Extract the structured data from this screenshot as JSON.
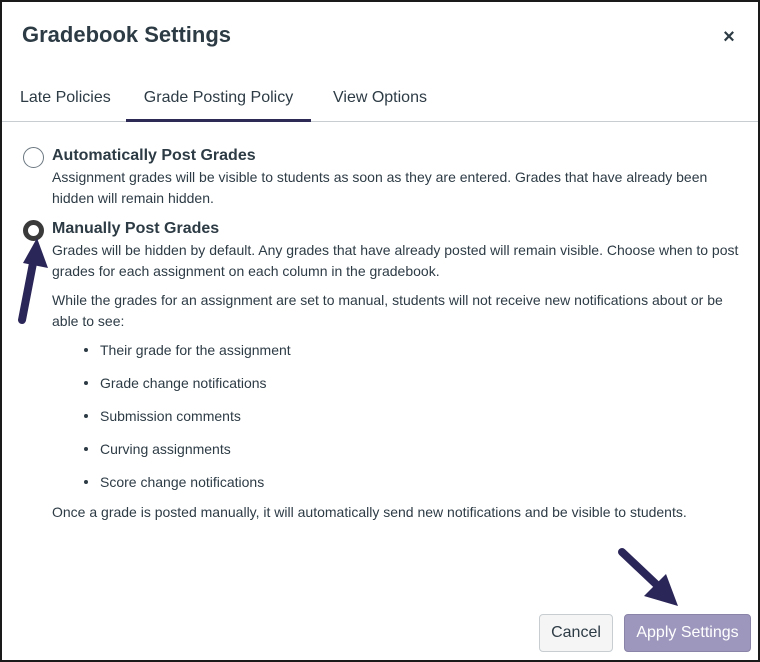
{
  "dialog": {
    "title": "Gradebook Settings",
    "close_glyph": "×"
  },
  "tabs": [
    {
      "label": "Late Policies",
      "active": false
    },
    {
      "label": "Grade Posting Policy",
      "active": true
    },
    {
      "label": "View Options",
      "active": false
    }
  ],
  "options": {
    "automatic": {
      "title": "Automatically Post Grades",
      "description": "Assignment grades will be visible to students as soon as they are entered. Grades that have already been hidden will remain hidden.",
      "selected": false
    },
    "manual": {
      "title": "Manually Post Grades",
      "description": "Grades will be hidden by default. Any grades that have already posted will remain visible. Choose when to post grades for each assignment on each column in the gradebook.",
      "selected": true,
      "manual_note": "While the grades for an assignment are set to manual, students will not receive new notifications about or be able to see:",
      "bullets": [
        "Their grade for the assignment",
        "Grade change notifications",
        "Submission comments",
        "Curving assignments",
        "Score change notifications"
      ],
      "footer_note": "Once a grade is posted manually, it will automatically send new notifications and be visible to students."
    }
  },
  "buttons": {
    "cancel": "Cancel",
    "apply": "Apply Settings"
  },
  "colors": {
    "text": "#2d3b45",
    "tab_underline": "#2d2a55",
    "apply_button": "#9e97bd",
    "annotation_arrow": "#2b2658"
  },
  "icons": {
    "close": "close-icon",
    "annotation": "arrow-annotation-icon"
  }
}
